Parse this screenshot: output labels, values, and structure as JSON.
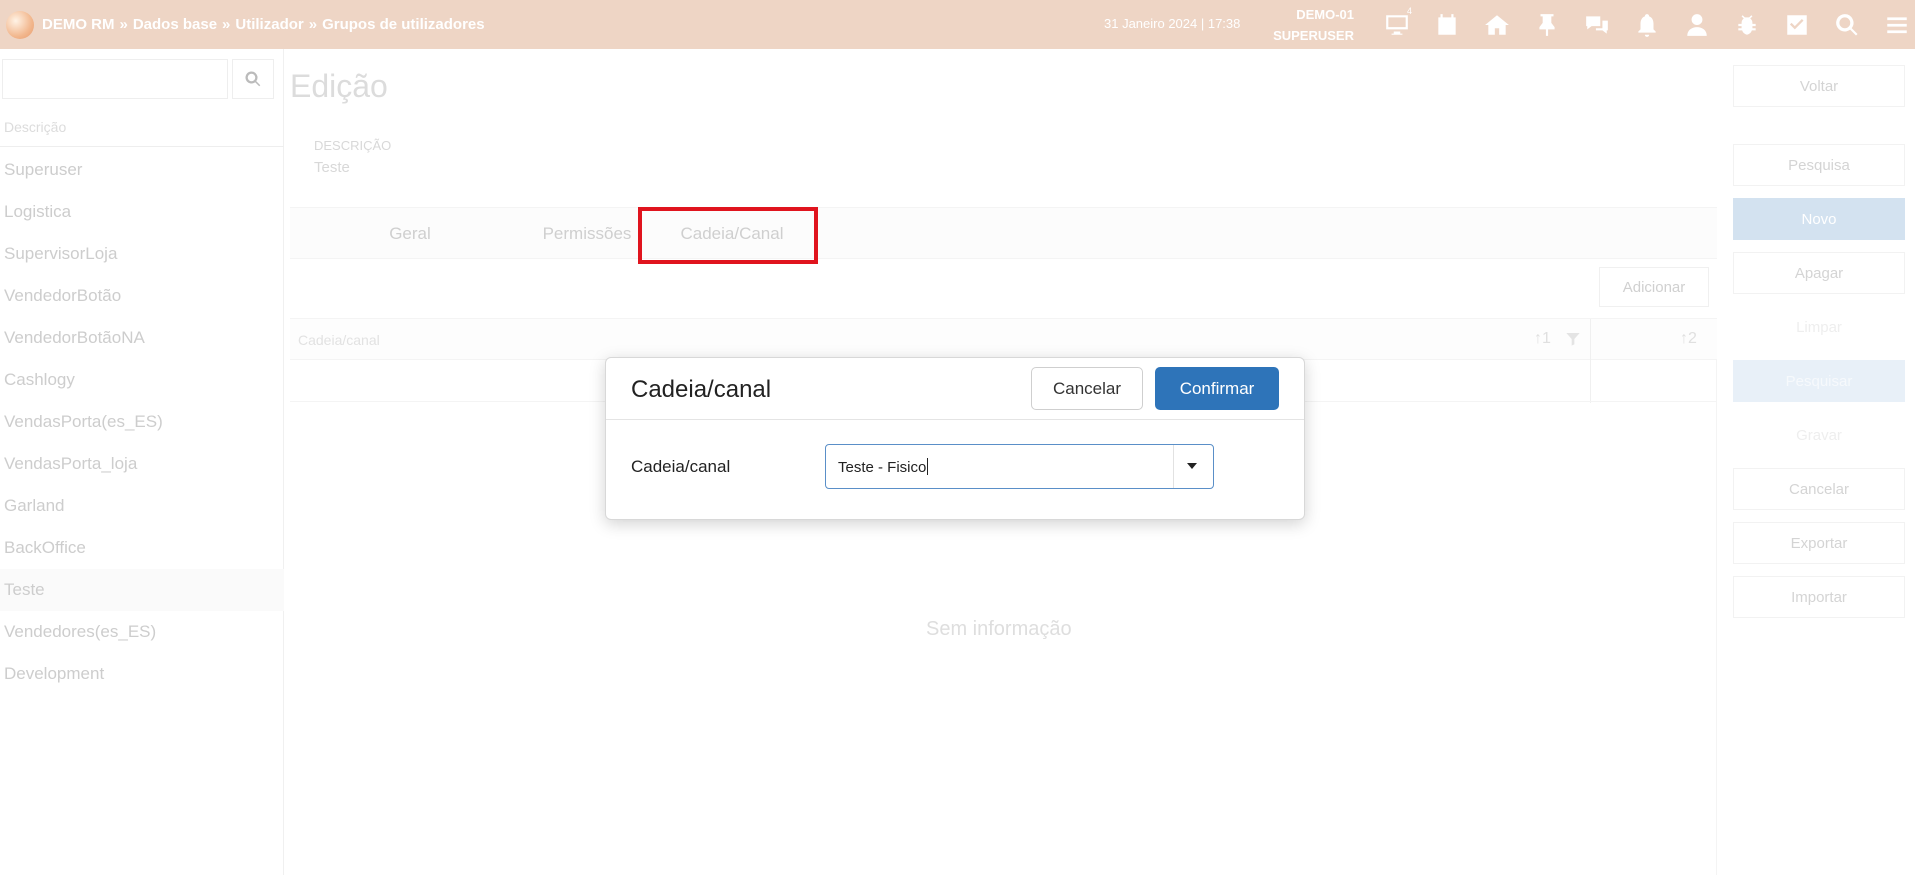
{
  "topbar": {
    "breadcrumb": [
      "DEMO RM",
      "Dados base",
      "Utilizador",
      "Grupos de utilizadores"
    ],
    "breadcrumb_sep": "»",
    "datetime": "31 Janeiro 2024 | 17:38",
    "store": "DEMO-01",
    "user": "SUPERUSER",
    "monitor_badge": "4",
    "icons": [
      "monitor-icon",
      "calendar-icon",
      "home-icon",
      "pin-icon",
      "chat-icon",
      "bell-icon",
      "user-icon",
      "bug-icon",
      "checkbox-icon",
      "search-icon",
      "menu-icon"
    ]
  },
  "sidebar": {
    "search_value": "",
    "list_header": "Descrição",
    "items": [
      "Superuser",
      "Logistica",
      "SupervisorLoja",
      "VendedorBotão",
      "VendedorBotãoNA",
      "Cashlogy",
      "VendasPorta(es_ES)",
      "VendasPorta_loja",
      "Garland",
      "BackOffice",
      "Teste",
      "Vendedores(es_ES)",
      "Development"
    ],
    "active_item": "Teste"
  },
  "main": {
    "title": "Edição",
    "description_label": "DESCRIÇÃO",
    "description_value": "Teste",
    "tabs": [
      "Geral",
      "Permissões",
      "Cadeia/Canal"
    ],
    "active_tab": "Cadeia/Canal",
    "add_label": "Adicionar",
    "grid": {
      "column": "Cadeia/canal",
      "sort1": "↑1",
      "sort2": "↑2"
    },
    "empty_text": "Sem informação"
  },
  "actions": [
    "Voltar",
    "Pesquisa",
    "Novo",
    "Apagar",
    "Limpar",
    "Pesquisar",
    "Gravar",
    "Cancelar",
    "Exportar",
    "Importar"
  ],
  "modal": {
    "title": "Cadeia/canal",
    "cancel_label": "Cancelar",
    "confirm_label": "Confirmar",
    "field_label": "Cadeia/canal",
    "field_value": "Teste - Fisico"
  },
  "colors": {
    "topbar": "#eed5c5",
    "primary": "#2e74b9",
    "highlight": "#e0141e"
  }
}
